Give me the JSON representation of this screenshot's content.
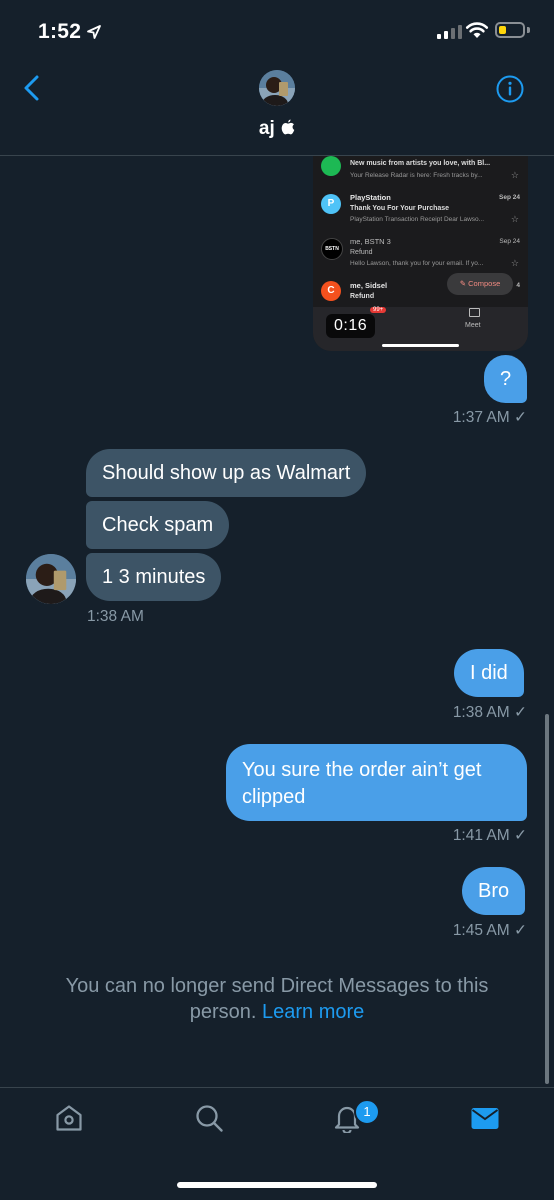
{
  "status_bar": {
    "time": "1:52"
  },
  "header": {
    "name": "aj",
    "name_icon": "apple-icon"
  },
  "video": {
    "duration": "0:16",
    "emails": [
      {
        "sender": "",
        "date": "",
        "subject": "New music from artists you love, with Bl...",
        "preview": "Your Release Radar is here: Fresh tracks by...",
        "icon_letter": "",
        "icon_color": "#1db954"
      },
      {
        "sender": "PlayStation",
        "date": "Sep 24",
        "subject": "Thank You For Your Purchase",
        "preview": "PlayStation Transaction Receipt Dear Lawso...",
        "icon_letter": "P",
        "icon_color": "#4fc3f7"
      },
      {
        "sender": "me, BSTN  3",
        "date": "Sep 24",
        "subject": "Refund",
        "preview": "Hello Lawson, thank you for your email. If yo...",
        "icon_letter": "BSTN",
        "icon_color": "#000000"
      },
      {
        "sender": "me, Sidsel",
        "date": "4",
        "subject": "Refund",
        "preview": "",
        "icon_letter": "C",
        "icon_color": "#f4511e"
      }
    ],
    "compose_label": "Compose",
    "meet_label": "Meet",
    "mail_badge": "99+"
  },
  "messages": [
    {
      "text": "?",
      "direction": "sent"
    },
    {
      "text": "Should show up as Walmart",
      "direction": "received"
    },
    {
      "text": "Check spam",
      "direction": "received"
    },
    {
      "text": "1 3 minutes",
      "direction": "received"
    },
    {
      "text": "I did",
      "direction": "sent"
    },
    {
      "text": "You sure the order ain’t get",
      "direction": "sent"
    },
    {
      "text": "clipped",
      "direction": "sent"
    },
    {
      "text": "Bro",
      "direction": "sent"
    }
  ],
  "timestamps": [
    "1:37 AM",
    "1:38 AM",
    "1:38 AM",
    "1:41 AM",
    "1:45 AM"
  ],
  "read_mark": "✓",
  "notice": {
    "line1": "You can no longer send Direct Messages to this",
    "line2": "person.",
    "link": "Learn more"
  },
  "tab_bar": {
    "notifications_badge": "1",
    "tabs": [
      "home",
      "search",
      "notifications",
      "messages"
    ]
  },
  "colors": {
    "background": "#15202b",
    "sent_bubble": "#4a9fe8",
    "received_bubble": "#3d5466",
    "accent": "#1d9bf0",
    "meta_text": "#8899a6"
  }
}
